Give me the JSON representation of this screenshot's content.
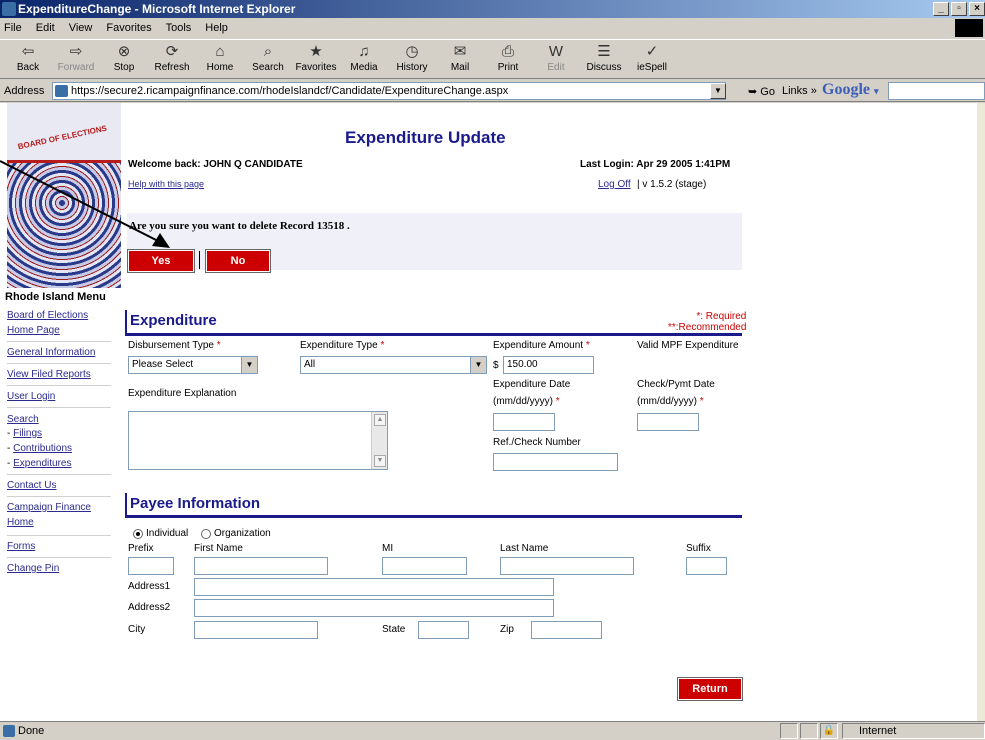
{
  "window": {
    "title": "ExpenditureChange - Microsoft Internet Explorer"
  },
  "menu": [
    "File",
    "Edit",
    "View",
    "Favorites",
    "Tools",
    "Help"
  ],
  "toolbar": [
    "Back",
    "Forward",
    "Stop",
    "Refresh",
    "Home",
    "Search",
    "Favorites",
    "Media",
    "History",
    "Mail",
    "Print",
    "Edit",
    "Discuss",
    "ieSpell"
  ],
  "address": {
    "label": "Address",
    "url": "https://secure2.ricampaignfinance.com/rhodeIslandcf/Candidate/ExpenditureChange.aspx",
    "go": "Go",
    "links": "Links",
    "google": "Google"
  },
  "logo_text": "BOARD OF ELECTIONS",
  "nav": {
    "title": "Rhode Island Menu",
    "items": {
      "board_of_elections": "Board of Elections",
      "home_page": "Home Page",
      "general_information": "General Information",
      "view_filed_reports": "View Filed Reports",
      "user_login": "User Login",
      "search": "Search",
      "filings": "Filings",
      "contributions": "Contributions",
      "expenditures": "Expenditures",
      "contact_us": "Contact Us",
      "campaign_finance": "Campaign Finance",
      "home": "Home",
      "forms": "Forms",
      "change_pin": "Change Pin"
    },
    "dash": "- "
  },
  "header": {
    "title": "Expenditure Update",
    "welcome": "Welcome back: JOHN Q CANDIDATE",
    "last_login": "Last Login: Apr 29 2005 1:41PM",
    "help": "Help with this page",
    "logoff": "Log Off",
    "version": "| v 1.5.2 (stage)"
  },
  "confirm": {
    "message": "Are you sure you want to delete Record 13518 .",
    "yes": "Yes",
    "no": "No"
  },
  "expenditure": {
    "section_title": "Expenditure",
    "required_note": "*: Required",
    "recommended_note": "**:Recommended",
    "star": "*",
    "disbursement_type_label": "Disbursement Type",
    "disbursement_type_value": "Please Select",
    "expenditure_type_label": "Expenditure Type",
    "expenditure_type_value": "All",
    "amount_label": "Expenditure Amount",
    "currency": "$",
    "amount_value": "150.00",
    "valid_mpf_label": "Valid MPF Expenditure",
    "explanation_label": "Expenditure Explanation",
    "date_label": "Expenditure Date",
    "date_format": "(mm/dd/yyyy)",
    "check_date_label": "Check/Pymt Date",
    "check_date_format": "(mm/dd/yyyy)",
    "ref_label": "Ref./Check Number"
  },
  "payee": {
    "section_title": "Payee Information",
    "individual": "Individual",
    "organization": "Organization",
    "prefix": "Prefix",
    "first_name": "First Name",
    "mi": "MI",
    "last_name": "Last Name",
    "suffix": "Suffix",
    "address1": "Address1",
    "address2": "Address2",
    "city": "City",
    "state": "State",
    "zip": "Zip"
  },
  "actions": {
    "return": "Return"
  },
  "status": {
    "text": "Done",
    "zone": "Internet"
  }
}
